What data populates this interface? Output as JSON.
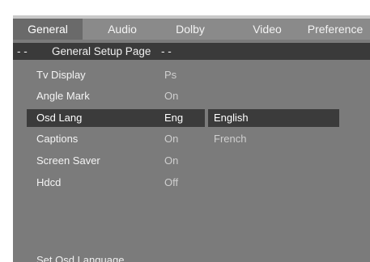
{
  "tabs": [
    {
      "label": "General",
      "active": true
    },
    {
      "label": "Audio",
      "active": false
    },
    {
      "label": "Dolby",
      "active": false
    },
    {
      "label": "Video",
      "active": false
    },
    {
      "label": "Preference",
      "active": false
    }
  ],
  "page_header": {
    "prefix": "- -",
    "title": "General Setup Page",
    "suffix": "- -"
  },
  "settings": [
    {
      "label": "Tv Display",
      "value": "Ps",
      "selected": false
    },
    {
      "label": "Angle Mark",
      "value": "On",
      "selected": false
    },
    {
      "label": "Osd Lang",
      "value": "Eng",
      "selected": true
    },
    {
      "label": "Captions",
      "value": "On",
      "selected": false
    },
    {
      "label": "Screen Saver",
      "value": "On",
      "selected": false
    },
    {
      "label": "Hdcd",
      "value": "Off",
      "selected": false
    }
  ],
  "options": [
    {
      "label": "English",
      "selected": true
    },
    {
      "label": "French",
      "selected": false
    }
  ],
  "status_text": "Set Osd Language"
}
